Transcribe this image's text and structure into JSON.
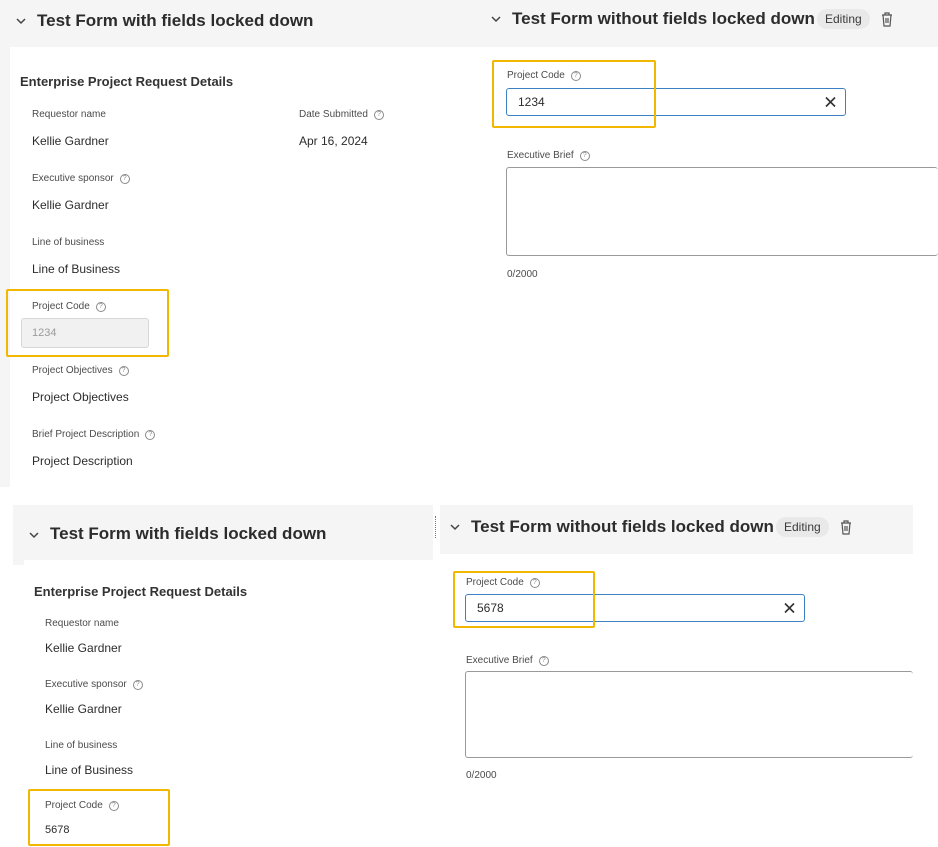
{
  "top": {
    "left_section": {
      "title": "Test Form with fields locked down"
    },
    "right_section": {
      "title": "Test Form without fields locked down",
      "badge": "Editing"
    },
    "form": {
      "title": "Enterprise Project Request Details",
      "requestor": {
        "label": "Requestor name",
        "value": "Kellie Gardner"
      },
      "date": {
        "label": "Date Submitted",
        "value": "Apr 16, 2024"
      },
      "sponsor": {
        "label": "Executive sponsor",
        "value": "Kellie Gardner"
      },
      "lob": {
        "label": "Line of business",
        "value": "Line of Business"
      },
      "project_code": {
        "label": "Project Code",
        "value": "1234"
      },
      "objectives": {
        "label": "Project Objectives",
        "value": "Project Objectives"
      },
      "description": {
        "label": "Brief Project Description",
        "value": "Project Description"
      }
    },
    "edit_form": {
      "project_code": {
        "label": "Project Code",
        "value": "1234"
      },
      "executive_brief": {
        "label": "Executive Brief",
        "counter": "0/2000"
      }
    }
  },
  "bottom": {
    "left_section": {
      "title": "Test Form with fields locked down"
    },
    "right_section": {
      "title": "Test Form without fields locked down",
      "badge": "Editing"
    },
    "form": {
      "title": "Enterprise Project Request Details",
      "requestor": {
        "label": "Requestor name",
        "value": "Kellie Gardner"
      },
      "sponsor": {
        "label": "Executive sponsor",
        "value": "Kellie Gardner"
      },
      "lob": {
        "label": "Line of business",
        "value": "Line of Business"
      },
      "project_code": {
        "label": "Project Code",
        "value": "5678"
      }
    },
    "edit_form": {
      "project_code": {
        "label": "Project Code",
        "value": "5678"
      },
      "executive_brief": {
        "label": "Executive Brief",
        "counter": "0/2000"
      }
    }
  },
  "icons": {
    "help": "question-circle-icon",
    "chevron": "chevron-down-icon",
    "clear": "close-icon",
    "delete": "trash-icon"
  },
  "colors": {
    "highlight": "#f2b800",
    "input_border": "#3b82c4",
    "pane_background": "#f5f5f5"
  }
}
